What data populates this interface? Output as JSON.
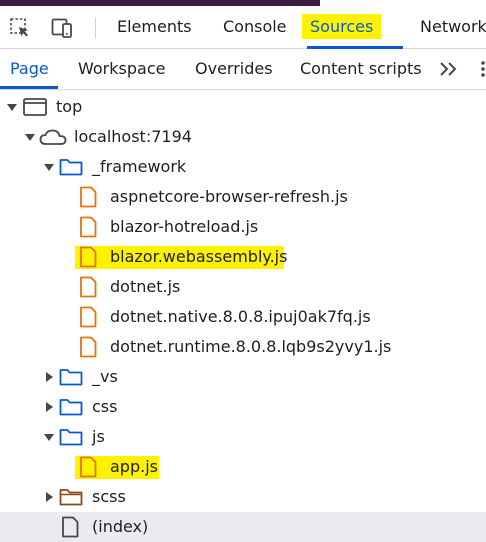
{
  "toolbar": {
    "inspect_icon": "element-picker-icon",
    "device_icon": "device-toggle-icon",
    "tabs": [
      {
        "label": "Elements"
      },
      {
        "label": "Console"
      },
      {
        "label": "Sources",
        "active": true,
        "highlighted": true
      },
      {
        "label": "Network"
      }
    ]
  },
  "subtabs": {
    "items": [
      {
        "label": "Page",
        "active": true
      },
      {
        "label": "Workspace"
      },
      {
        "label": "Overrides"
      },
      {
        "label": "Content scripts"
      }
    ],
    "more_icon": "double-chevron-right-icon",
    "menu_icon": "kebab-menu-icon"
  },
  "tree": {
    "top": "top",
    "origin": "localhost:7194",
    "framework_folder": "_framework",
    "framework_files": [
      "aspnetcore-browser-refresh.js",
      "blazor-hotreload.js",
      "blazor.webassembly.js",
      "dotnet.js",
      "dotnet.native.8.0.8.ipuj0ak7fq.js",
      "dotnet.runtime.8.0.8.lqb9s2yvy1.js"
    ],
    "vs_folder": "_vs",
    "css_folder": "css",
    "js_folder": "js",
    "js_files": [
      "app.js"
    ],
    "scss_folder": "scss",
    "index_file": "(index)"
  },
  "colors": {
    "accent": "#0b57d0",
    "highlight": "#fff200",
    "folder": "#0b57d0",
    "scss_folder": "#8a4b1a",
    "file_script": "#e8710a",
    "selected_row": "#e9ebee"
  }
}
